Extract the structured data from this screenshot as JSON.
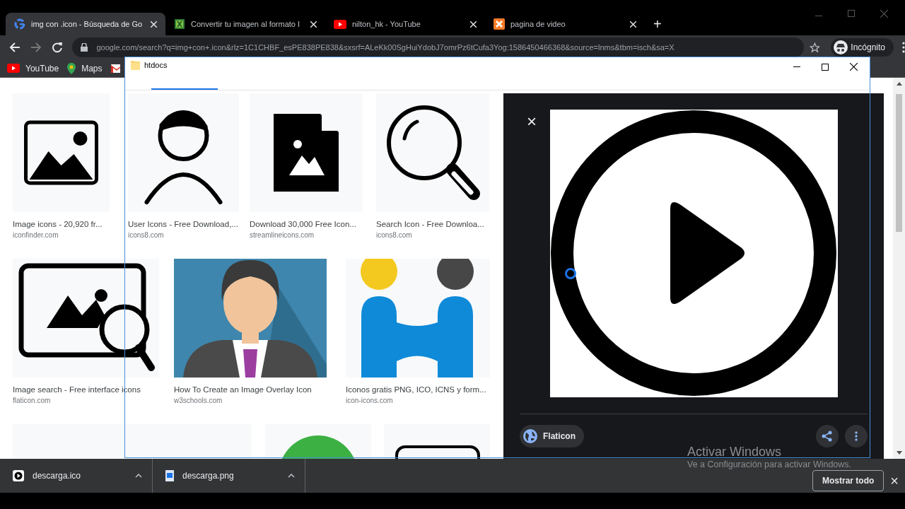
{
  "browser": {
    "tabs": [
      {
        "title": "img con .icon - Búsqueda de Go",
        "kind": "google",
        "selected": true
      },
      {
        "title": "Convertir tu imagen al formato I",
        "kind": "sheet",
        "selected": false
      },
      {
        "title": "nilton_hk - YouTube",
        "kind": "youtube",
        "selected": false
      },
      {
        "title": "pagina de video",
        "kind": "xampp",
        "selected": false
      }
    ],
    "new_tab": "+",
    "url": "google.com/search?q=img+con+.icon&rlz=1C1CHBF_esPE838PE838&sxsrf=ALeKk00SgHuiYdobJ7omrPz6tCufa3Yog:1586450466368&source=lnms&tbm=isch&sa=X",
    "profile": "Incógnito",
    "bookmarks": [
      {
        "label": "YouTube",
        "kind": "youtube"
      },
      {
        "label": "Maps",
        "kind": "maps"
      },
      {
        "kind": "gmail"
      }
    ]
  },
  "results": [
    [
      {
        "kind": "image",
        "title": "Image icons - 20,920 fr...",
        "source": "iconfinder.com"
      },
      {
        "kind": "user",
        "title": "User Icons - Free Download,...",
        "source": "icons8.com"
      },
      {
        "kind": "file",
        "title": "Download 30,000 Free Icon...",
        "source": "streamlineicons.com"
      },
      {
        "kind": "search",
        "title": "Search Icon - Free Downloa...",
        "source": "icons8.com"
      }
    ],
    [
      {
        "kind": "imagesearch",
        "title": "Image search - Free interface icons",
        "source": "flaticon.com"
      },
      {
        "kind": "person",
        "title": "How To Create an Image Overlay Icon",
        "source": "w3schools.com"
      },
      {
        "kind": "letter",
        "title": "Iconos gratis PNG, ICO, ICNS y form...",
        "source": "icon-icons.com"
      }
    ],
    [
      {
        "kind": "blank"
      },
      {
        "kind": "circle"
      },
      {
        "kind": "device"
      }
    ]
  ],
  "preview": {
    "close": "×",
    "source": "Flaticon"
  },
  "explorer_window": {
    "title": "htdocs"
  },
  "activation": {
    "title": "Activar Windows",
    "message": "Ve a Configuración para activar Windows."
  },
  "downloads": {
    "files": [
      {
        "name": "descarga.ico",
        "kind": "ico"
      },
      {
        "name": "descarga.png",
        "kind": "png"
      }
    ],
    "show_all": "Mostrar todo",
    "close": "×"
  }
}
